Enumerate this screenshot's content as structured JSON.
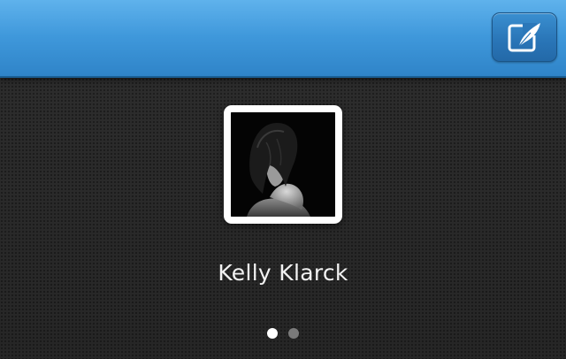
{
  "header": {
    "compose_button": {
      "icon": "compose-quill-icon",
      "color": "#2a76b8"
    },
    "color": "#3f98db"
  },
  "profile": {
    "name": "Kelly Klarck",
    "avatar": "profile-photo"
  },
  "pagination": {
    "current": 1,
    "total": 2
  }
}
